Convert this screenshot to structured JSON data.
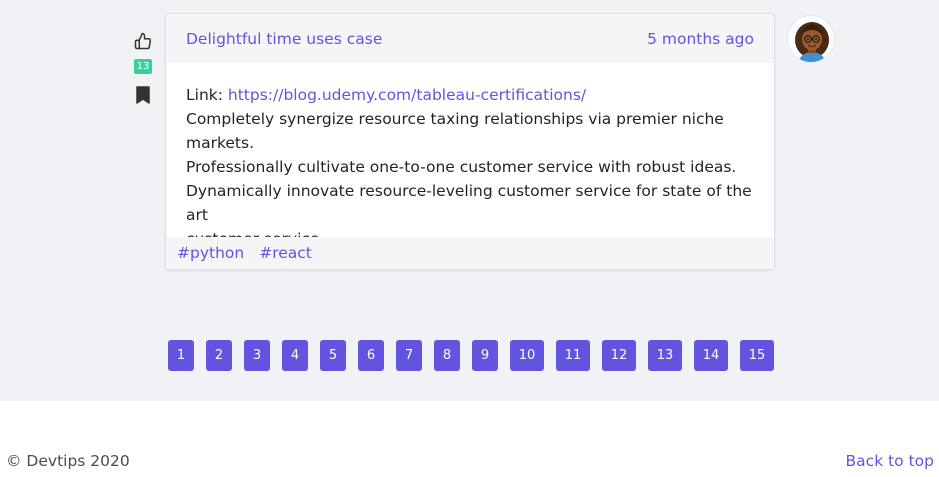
{
  "post": {
    "likes": "13",
    "title": "Delightful time uses case",
    "time_ago": "5 months ago",
    "link_label": "Link:",
    "link_url": "https://blog.udemy.com/tableau-certifications/",
    "body_lines": [
      "Completely synergize resource taxing relationships via premier niche markets.",
      "Professionally cultivate one-to-one customer service with robust ideas.",
      "Dynamically innovate resource-leveling customer service for state of the art",
      "customer service."
    ],
    "tags": [
      "#python",
      "#react"
    ]
  },
  "pagination": [
    "1",
    "2",
    "3",
    "4",
    "5",
    "6",
    "7",
    "8",
    "9",
    "10",
    "11",
    "12",
    "13",
    "14",
    "15"
  ],
  "footer": {
    "copyright": "© Devtips 2020",
    "back_to_top": "Back to top"
  },
  "colors": {
    "accent": "#6354e0",
    "badge": "#34d399",
    "page_bg": "#f0f2f5"
  }
}
